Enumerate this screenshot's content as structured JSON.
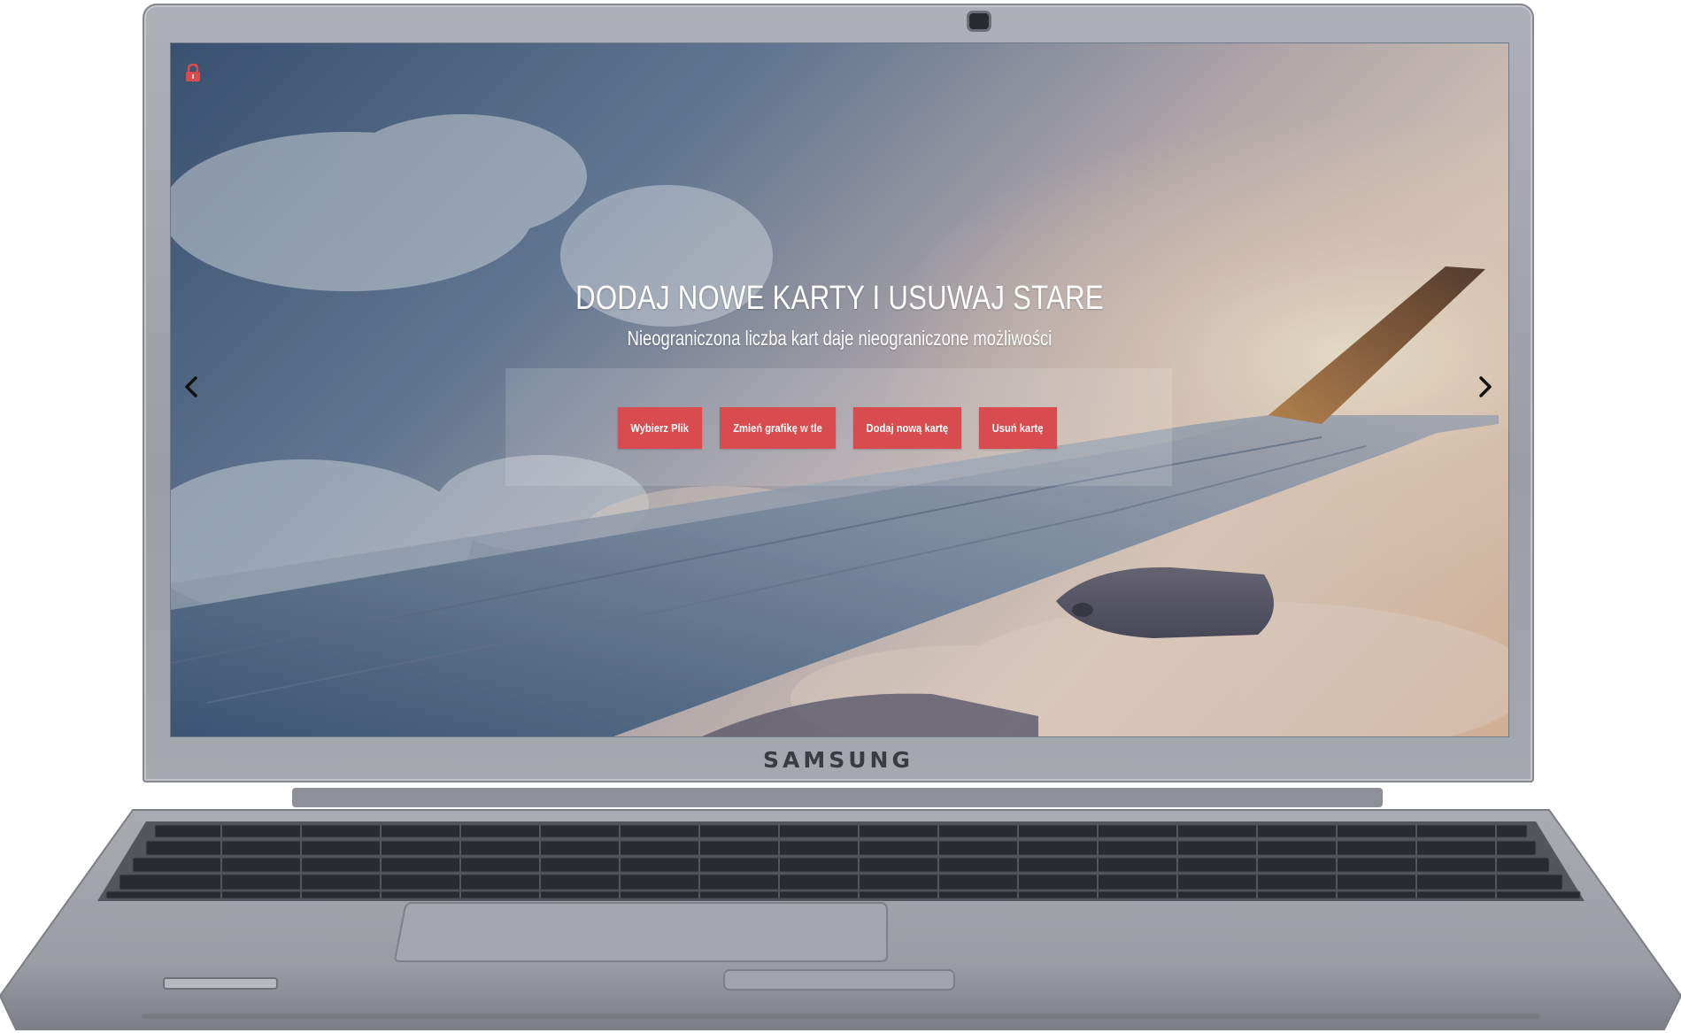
{
  "device": {
    "brand": "SAMSUNG"
  },
  "colors": {
    "accent": "#d84b4f",
    "text": "#ffffff"
  },
  "slide": {
    "title": "DODAJ NOWE KARTY I USUWAJ STARE",
    "subtitle": "Nieograniczona liczba kart daje nieograniczone możliwości"
  },
  "actions": [
    {
      "label": "Wybierz Plik"
    },
    {
      "label": "Zmień grafikę w tle"
    },
    {
      "label": "Dodaj nową kartę"
    },
    {
      "label": "Usuń kartę"
    }
  ],
  "icons": {
    "lock": "padlock-icon",
    "prev": "chevron-left-icon",
    "next": "chevron-right-icon",
    "camera": "webcam-icon"
  }
}
